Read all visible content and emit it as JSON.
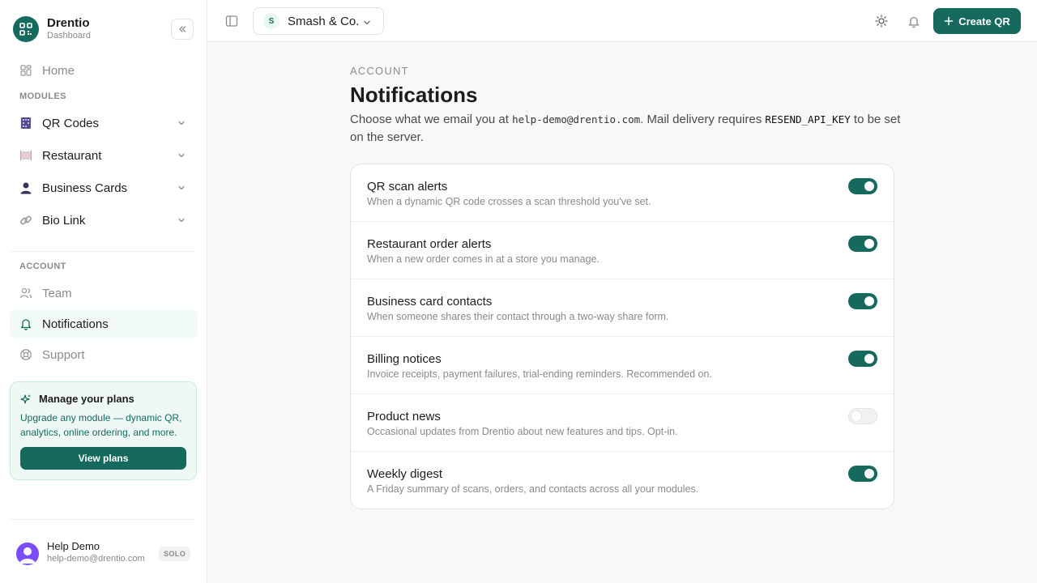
{
  "brand": {
    "name": "Drentio",
    "subtitle": "Dashboard"
  },
  "sidebar": {
    "home_label": "Home",
    "modules_heading": "MODULES",
    "modules": [
      {
        "label": "QR Codes",
        "icon": "qr-codes-icon"
      },
      {
        "label": "Restaurant",
        "icon": "restaurant-icon"
      },
      {
        "label": "Business Cards",
        "icon": "business-cards-icon"
      },
      {
        "label": "Bio Link",
        "icon": "link-icon"
      }
    ],
    "account_heading": "ACCOUNT",
    "account_items": [
      {
        "label": "Team",
        "icon": "team-icon"
      },
      {
        "label": "Notifications",
        "icon": "bell-icon",
        "active": true
      },
      {
        "label": "Support",
        "icon": "lifebuoy-icon"
      }
    ],
    "plan_card": {
      "title": "Manage your plans",
      "description": "Upgrade any module — dynamic QR, analytics, online ordering, and more.",
      "button_label": "View plans"
    },
    "user": {
      "name": "Help Demo",
      "email": "help-demo@drentio.com",
      "badge": "SOLO"
    }
  },
  "topbar": {
    "org_initial": "S",
    "org_name": "Smash & Co.",
    "create_label": "Create QR"
  },
  "main": {
    "eyebrow": "ACCOUNT",
    "title": "Notifications",
    "intro_1": "Choose what we email you at ",
    "intro_email": "help-demo@drentio.com",
    "intro_2": ". Mail delivery requires ",
    "intro_key": "RESEND_API_KEY",
    "intro_3": " to be set on the server.",
    "settings": [
      {
        "title": "QR scan alerts",
        "description": "When a dynamic QR code crosses a scan threshold you've set.",
        "enabled": true
      },
      {
        "title": "Restaurant order alerts",
        "description": "When a new order comes in at a store you manage.",
        "enabled": true
      },
      {
        "title": "Business card contacts",
        "description": "When someone shares their contact through a two-way share form.",
        "enabled": true
      },
      {
        "title": "Billing notices",
        "description": "Invoice receipts, payment failures, trial-ending reminders. Recommended on.",
        "enabled": true
      },
      {
        "title": "Product news",
        "description": "Occasional updates from Drentio about new features and tips. Opt-in.",
        "enabled": false
      },
      {
        "title": "Weekly digest",
        "description": "A Friday summary of scans, orders, and contacts across all your modules.",
        "enabled": true
      }
    ]
  },
  "colors": {
    "accent": "#16695d",
    "accent_soft": "#eef8f5",
    "muted": "#8a8a8a"
  }
}
